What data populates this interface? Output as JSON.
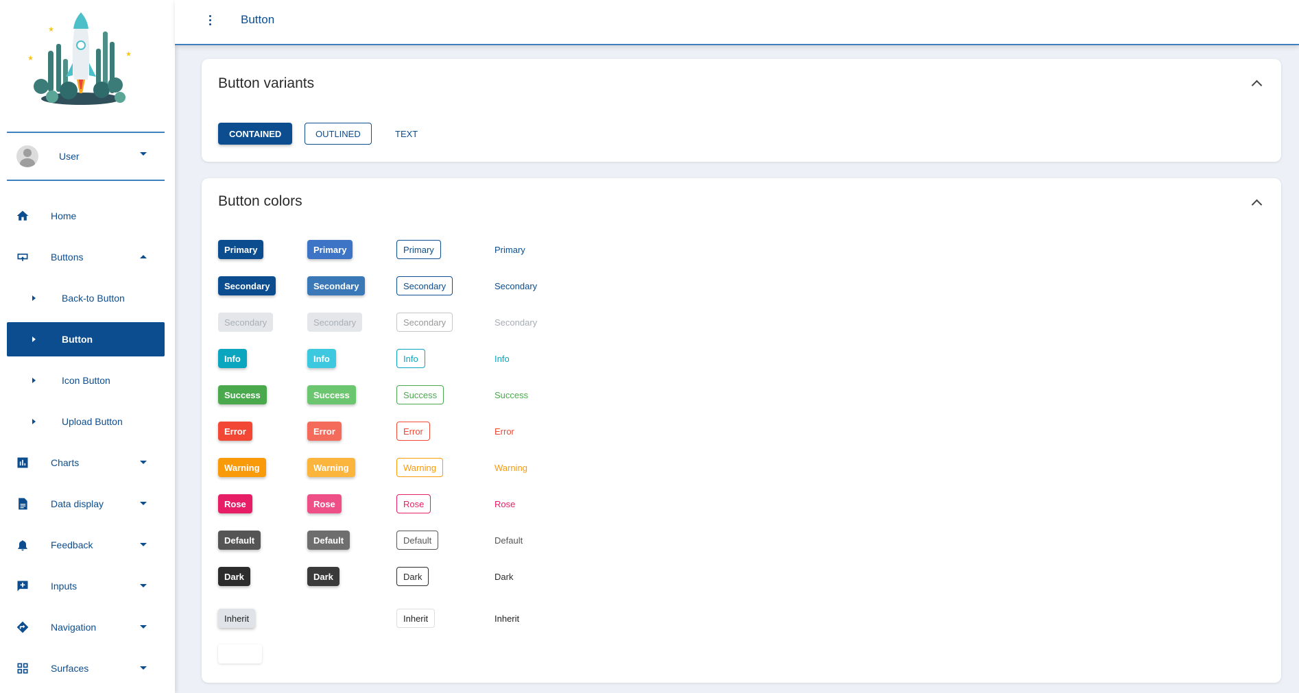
{
  "sidebar": {
    "user": {
      "label": "User"
    },
    "items": [
      {
        "label": "Home",
        "icon": "home-icon"
      },
      {
        "label": "Buttons",
        "icon": "keyboard-icon"
      },
      {
        "label": "Charts",
        "icon": "bar-chart-icon"
      },
      {
        "label": "Data display",
        "icon": "document-icon"
      },
      {
        "label": "Feedback",
        "icon": "bell-icon"
      },
      {
        "label": "Inputs",
        "icon": "add-comment-icon"
      },
      {
        "label": "Navigation",
        "icon": "directions-icon"
      },
      {
        "label": "Surfaces",
        "icon": "grid-icon"
      }
    ],
    "subitems": [
      {
        "label": "Back-to Button"
      },
      {
        "label": "Button"
      },
      {
        "label": "Icon Button"
      },
      {
        "label": "Upload Button"
      }
    ]
  },
  "topbar": {
    "title": "Button"
  },
  "variants_card": {
    "title": "Button variants",
    "buttons": {
      "contained": "CONTAINED",
      "outlined": "OUTLINED",
      "text": "TEXT"
    }
  },
  "colors_card": {
    "title": "Button colors",
    "rows": [
      {
        "label": "Primary",
        "color": "#0b4d8f",
        "light": "#3d74c5"
      },
      {
        "label": "Secondary",
        "color": "#0b4d8f",
        "light": "#3a78b8"
      },
      {
        "label": "Secondary",
        "color": "#b6bcc4",
        "light": "#c0c5cc",
        "disabled": true
      },
      {
        "label": "Info",
        "color": "#0aa5bf",
        "light": "#3cc9df"
      },
      {
        "label": "Success",
        "color": "#4aa84d",
        "light": "#6cc66f"
      },
      {
        "label": "Error",
        "color": "#f24735",
        "light": "#f46a5b"
      },
      {
        "label": "Warning",
        "color": "#f99a0b",
        "light": "#fbb53c"
      },
      {
        "label": "Rose",
        "color": "#e71d65",
        "light": "#ee4f86"
      },
      {
        "label": "Default",
        "color": "#555555",
        "light": "#6e6e6e"
      },
      {
        "label": "Dark",
        "color": "#2c2c2c",
        "light": "#3a3a3a"
      },
      {
        "label": "Inherit",
        "color": "#222222"
      }
    ]
  },
  "colors": {
    "accent": "#0b4d8f"
  }
}
